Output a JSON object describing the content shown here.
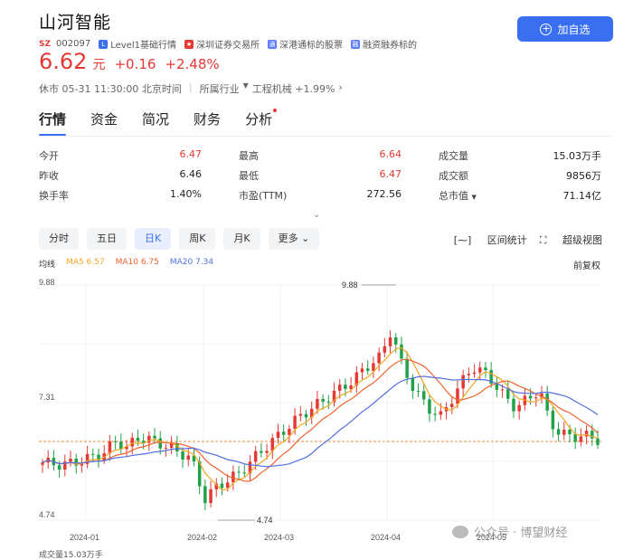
{
  "stock": {
    "name": "山河智能",
    "market_badge": "SZ",
    "code": "002097",
    "tags": [
      "Level1基础行情",
      "深圳证券交易所",
      "深港通标的股票",
      "融资融券标的"
    ],
    "add_button": "加自选",
    "price": "6.62",
    "unit": "元",
    "change": "+0.16",
    "change_pct": "+2.48%",
    "status_time": "休市 05-31 11:30:00 北京时间",
    "industry_label": "所属行业",
    "industry": "工程机械 +1.99%"
  },
  "tabs": [
    "行情",
    "资金",
    "简况",
    "财务",
    "分析"
  ],
  "stats": [
    [
      {
        "label": "今开",
        "value": "6.47",
        "red": true
      },
      {
        "label": "最高",
        "value": "6.64",
        "red": true
      },
      {
        "label": "成交量",
        "value": "15.03万手",
        "red": false
      }
    ],
    [
      {
        "label": "昨收",
        "value": "6.46",
        "red": false
      },
      {
        "label": "最低",
        "value": "6.47",
        "red": true
      },
      {
        "label": "成交额",
        "value": "9856万",
        "red": false
      }
    ],
    [
      {
        "label": "换手率",
        "value": "1.40%",
        "red": false
      },
      {
        "label": "市盈(TTM)",
        "value": "272.56",
        "red": false
      },
      {
        "label": "总市值",
        "value": "71.14亿",
        "red": false
      }
    ]
  ],
  "periods": [
    "分时",
    "五日",
    "日K",
    "周K",
    "月K",
    "更多"
  ],
  "tools": [
    "区间统计",
    "超级视图"
  ],
  "ma": {
    "title": "均线",
    "ma5": "MA5 6.57",
    "ma10": "MA10 6.75",
    "ma20": "MA20 7.34",
    "fq": "前复权"
  },
  "chart_data": {
    "type": "candlestick",
    "y_ticks": [
      "9.88",
      "7.31",
      "4.74"
    ],
    "x_ticks": [
      "2024-01",
      "2024-02",
      "2024-03",
      "2024-04",
      "2024-05"
    ],
    "high_label": "9.88",
    "low_label": "4.74",
    "prev_close": 6.46,
    "ylim": [
      4.74,
      9.88
    ],
    "colors": {
      "up": "#e53935",
      "down": "#21a24a",
      "ma5": "#f5a623",
      "ma10": "#f0642d",
      "ma20": "#4f6fe0"
    }
  },
  "volume_label": "成交量15.03万手",
  "watermark": "公众号 · 博望财经"
}
